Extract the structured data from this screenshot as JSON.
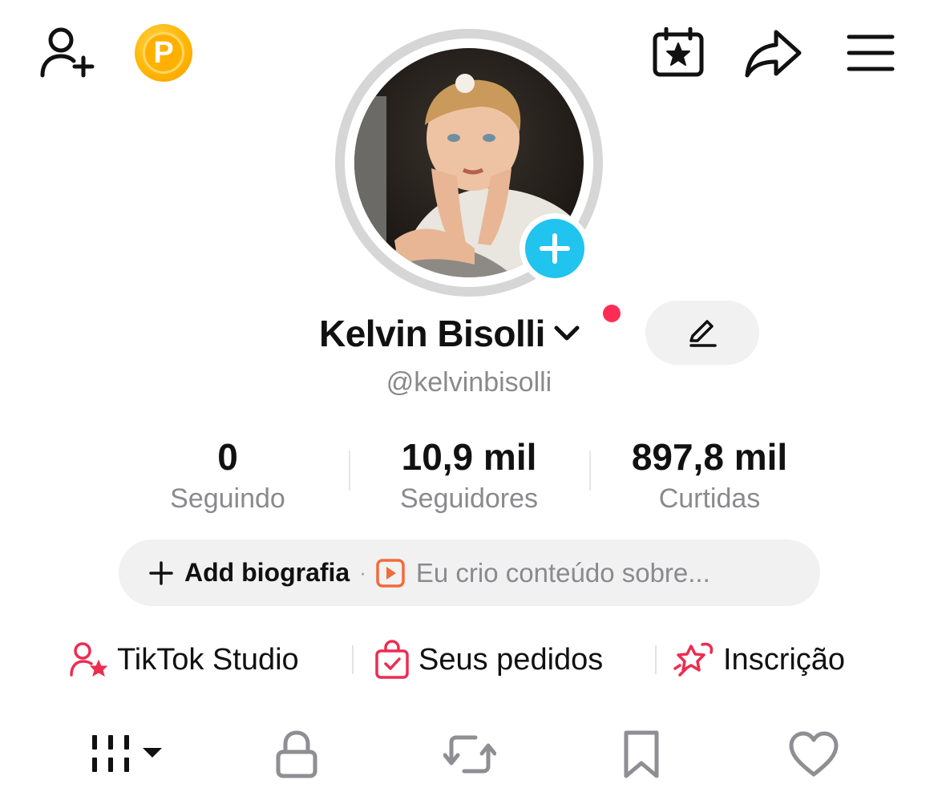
{
  "profile": {
    "display_name": "Kelvin Bisolli",
    "handle": "@kelvinbisolli",
    "coin_letter": "P"
  },
  "stats": [
    {
      "value": "0",
      "label": "Seguindo"
    },
    {
      "value": "10,9 mil",
      "label": "Seguidores"
    },
    {
      "value": "897,8 mil",
      "label": "Curtidas"
    }
  ],
  "bio": {
    "add_label": "Add biografia",
    "separator": "·",
    "suggestion": "Eu crio conteúdo sobre..."
  },
  "tools": [
    {
      "label": "TikTok Studio",
      "icon": "person-star-icon"
    },
    {
      "label": "Seus pedidos",
      "icon": "shopping-bag-icon"
    },
    {
      "label": "Inscrição",
      "icon": "rocket-star-icon"
    }
  ],
  "tabs": [
    {
      "name": "videos-grid-icon"
    },
    {
      "name": "lock-icon"
    },
    {
      "name": "repost-icon"
    },
    {
      "name": "bookmark-icon"
    },
    {
      "name": "heart-icon"
    }
  ],
  "colors": {
    "accent_red": "#ff2d55",
    "add_blue": "#20c4ef",
    "coin_gold": "#ffb300",
    "muted_text": "#8a8a8e"
  }
}
